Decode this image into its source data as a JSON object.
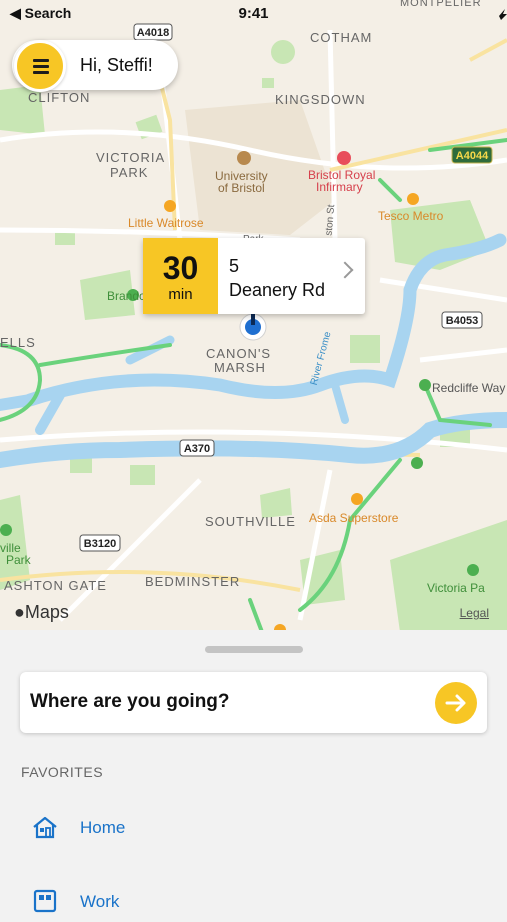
{
  "status_bar": {
    "back_label": "◀ Search",
    "time": "9:41"
  },
  "header": {
    "greeting": "Hi, Steffi!"
  },
  "eta_card": {
    "minutes": "30",
    "unit": "min",
    "address_line1": "5",
    "address_line2": "Deanery Rd"
  },
  "map": {
    "labels": {
      "cotham": "COTHAM",
      "kingsdown": "KINGSDOWN",
      "clifton": "CLIFTON",
      "victoria_park": "VICTORIA",
      "victoria_park2": "PARK",
      "uni1": "University",
      "uni2": "of Bristol",
      "bri1": "Bristol Royal",
      "bri2": "Infirmary",
      "tesco": "Tesco Metro",
      "waitrose": "Little Waitrose",
      "brandon": "Brando",
      "canons1": "CANON'S",
      "canons2": "MARSH",
      "ells": "ELLS",
      "redcliffe": "Redcliffe Way",
      "southville": "SOUTHVILLE",
      "asda": "Asda Superstore",
      "ville1": "ville",
      "ville2": "Park",
      "ashton": "ASHTON GATE",
      "bedminster": "BEDMINSTER",
      "victoria_park_s": "Victoria Pa",
      "river_frome": "River Frome",
      "park_st": "Park",
      "sts": "ston St",
      "monte": "MONTPELIER"
    },
    "road_badges": {
      "a4018": "A4018",
      "a4044": "A4044",
      "b4053": "B4053",
      "a370": "A370",
      "b3120": "B3120"
    },
    "attribution": "Maps",
    "legal": "Legal"
  },
  "sheet": {
    "search_placeholder": "Where are you going?",
    "favorites_title": "FAVORITES",
    "favorites": [
      {
        "label": "Home",
        "icon": "home-icon"
      },
      {
        "label": "Work",
        "icon": "work-icon"
      }
    ]
  },
  "colors": {
    "accent": "#f7c625",
    "link": "#1a73c9",
    "water": "#a8d4f0",
    "park": "#c8e6b4",
    "route": "#6ad27c"
  }
}
